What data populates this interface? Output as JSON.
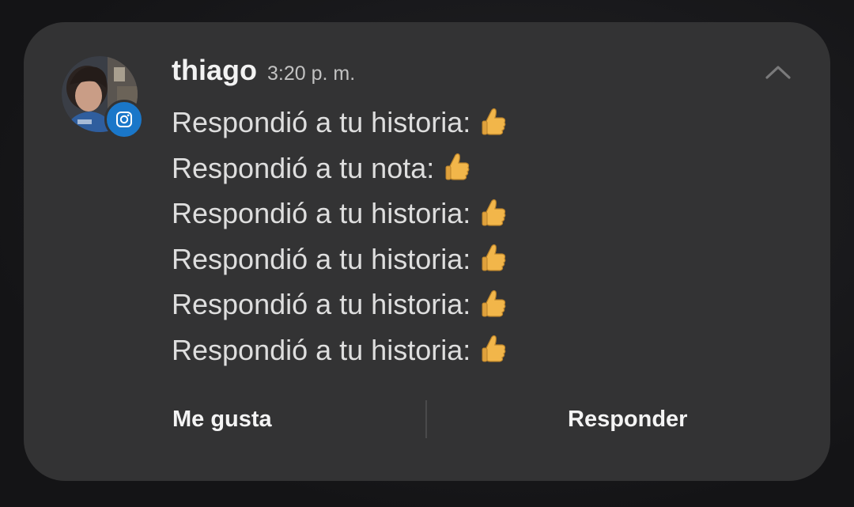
{
  "notification": {
    "sender": "thiago",
    "time": "3:20 p. m.",
    "app_icon": "instagram-icon",
    "avatar": "profile-photo",
    "collapse_icon": "chevron-up-icon",
    "messages": [
      {
        "text": "Respondió a tu historia:",
        "emoji": "thumbs-up-icon"
      },
      {
        "text": "Respondió a tu nota:",
        "emoji": "thumbs-up-icon"
      },
      {
        "text": "Respondió a tu historia:",
        "emoji": "thumbs-up-icon"
      },
      {
        "text": "Respondió a tu historia:",
        "emoji": "thumbs-up-icon"
      },
      {
        "text": "Respondió a tu historia:",
        "emoji": "thumbs-up-icon"
      },
      {
        "text": "Respondió a tu historia:",
        "emoji": "thumbs-up-icon"
      }
    ],
    "actions": {
      "like_label": "Me gusta",
      "reply_label": "Responder"
    }
  },
  "colors": {
    "card_background": "#333334",
    "badge": "#1a77c9",
    "emoji": "#f2b64a"
  }
}
